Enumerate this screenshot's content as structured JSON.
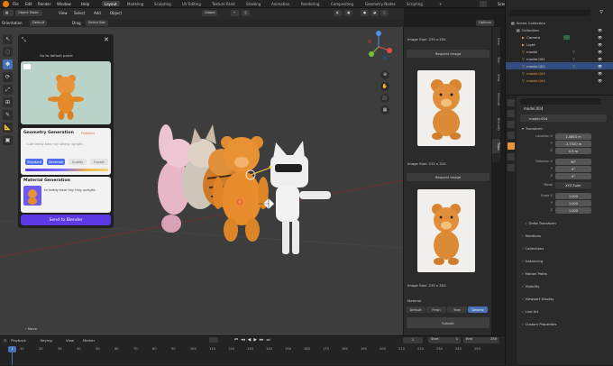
{
  "topbar": {
    "menus": [
      "File",
      "Edit",
      "Render",
      "Window",
      "Help"
    ],
    "workspaces": [
      "Layout",
      "Modeling",
      "Sculpting",
      "UV Editing",
      "Texture Paint",
      "Shading",
      "Animation",
      "Rendering",
      "Compositing",
      "Geometry Nodes",
      "Scripting"
    ],
    "active_workspace": "Layout",
    "scene_label": "Scene",
    "viewlayer_label": "ViewLayer"
  },
  "header": {
    "mode": "Object Mode",
    "menus": [
      "View",
      "Select",
      "Add",
      "Object"
    ],
    "orientation_label": "Orientation",
    "orientation_value": "Default",
    "drag_label": "Drag",
    "drag_value": "Select Box",
    "pivot_value": "Global",
    "options_label": "Options"
  },
  "plugin": {
    "go_label": "Go to default panel",
    "geo_title": "Geometry Generation",
    "geo_badge": "Finished",
    "geo_prompt": "Cute teddy bear toy sitting upright.",
    "geo_chips": [
      "Standard",
      "Generate",
      "Quality",
      "Export"
    ],
    "mat_title": "Material Generation",
    "mat_prompt": "te teddy bear toy ting upright.",
    "send_label": "Send to Blender"
  },
  "right_panel": {
    "image_size_1": "Image Size: 235 x 254",
    "image_size_2": "Image Size: 232 x 310",
    "image_size_3": "Image Size: 235 x 303",
    "regen_label": "Request Image",
    "mat_section": "Material",
    "mat_tabs": [
      "Default",
      "Fresh",
      "Toon",
      "Generic"
    ],
    "active_mat_tab": "Generic",
    "submit_label": "Submit"
  },
  "side_tabs": [
    "Item",
    "Tool",
    "View",
    "Meshcat",
    "Blendify",
    "Tripo"
  ],
  "outliner": {
    "root": "Scene Collection",
    "items": [
      {
        "label": "Collection",
        "highlight": false,
        "depth": 1
      },
      {
        "label": "Camera",
        "highlight": false,
        "depth": 2
      },
      {
        "label": "Light",
        "highlight": false,
        "depth": 2
      },
      {
        "label": "model",
        "highlight": false,
        "depth": 2
      },
      {
        "label": "model.001",
        "highlight": false,
        "depth": 2
      },
      {
        "label": "model.002",
        "highlight": true,
        "depth": 2
      },
      {
        "label": "model.003",
        "highlight": false,
        "depth": 2
      },
      {
        "label": "model.004",
        "highlight": false,
        "depth": 2
      }
    ]
  },
  "properties": {
    "object_name": "model.004",
    "object_name_2": "model.004",
    "transform_label": "Transform",
    "location_label": "Location X",
    "location": [
      "1.0653 m",
      "-1.7320 m",
      "0.5 m"
    ],
    "rotation_label": "Rotation X",
    "rotation": [
      "90°",
      "0°",
      "0°"
    ],
    "mode_label": "Mode",
    "mode_value": "XYZ Euler",
    "scale_label": "Scale X",
    "scale": [
      "1.000",
      "1.000",
      "1.000"
    ],
    "axis_y": "Y",
    "axis_z": "Z",
    "sections": [
      "Delta Transform",
      "Relations",
      "Collections",
      "Instancing",
      "Motion Paths",
      "Visibility",
      "Viewport Display",
      "Line Art",
      "Custom Properties"
    ]
  },
  "timeline": {
    "menus": [
      "Playback",
      "Keying",
      "View",
      "Marker"
    ],
    "ticks": [
      "0",
      "10",
      "20",
      "30",
      "40",
      "50",
      "60",
      "70",
      "80",
      "90",
      "100",
      "110",
      "120",
      "130",
      "140",
      "150",
      "160",
      "170",
      "180",
      "190",
      "200",
      "210",
      "220",
      "230",
      "240",
      "250"
    ],
    "current_frame": "1",
    "start_label": "Start",
    "start_value": "1",
    "end_label": "End",
    "end_value": "250",
    "move_label": "Move"
  },
  "colors": {
    "accent": "#4772b3",
    "purple": "#5b3ae6",
    "orange": "#e58a2b"
  }
}
